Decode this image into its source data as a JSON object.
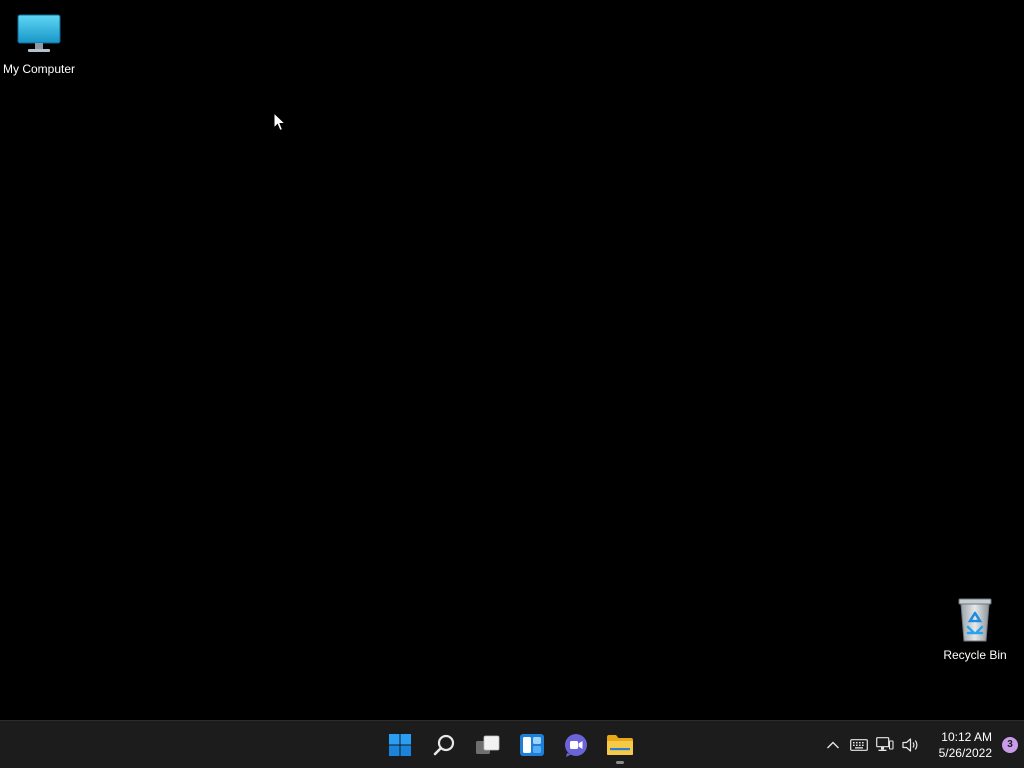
{
  "desktop": {
    "icons": [
      {
        "label": "My Computer",
        "icon": "monitor-icon"
      },
      {
        "label": "Recycle Bin",
        "icon": "recycle-bin-icon"
      }
    ]
  },
  "taskbar": {
    "pinned": [
      {
        "name": "start",
        "icon": "windows-logo-icon"
      },
      {
        "name": "search",
        "icon": "search-icon"
      },
      {
        "name": "task-view",
        "icon": "task-view-icon"
      },
      {
        "name": "widgets",
        "icon": "widgets-icon"
      },
      {
        "name": "chat",
        "icon": "chat-icon"
      },
      {
        "name": "file-explorer",
        "icon": "folder-icon"
      }
    ],
    "tray": {
      "icons": [
        "chevron-up-icon",
        "keyboard-icon",
        "network-icon",
        "speaker-icon"
      ],
      "time": "10:12 AM",
      "date": "5/26/2022",
      "notification_count": "3"
    }
  },
  "colors": {
    "desktop_background": "#000000",
    "taskbar_background": "#1c1c1c",
    "accent": "#0078d4",
    "notification_badge": "#c89ce8"
  }
}
